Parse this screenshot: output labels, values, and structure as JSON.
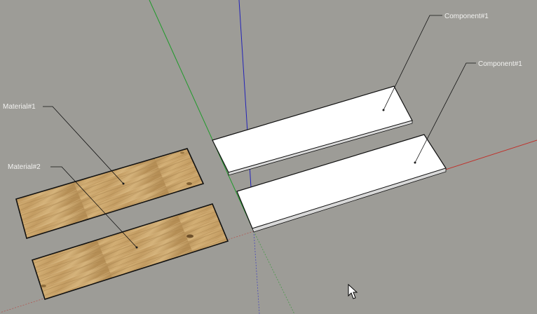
{
  "scene": {
    "background_color": "#9d9c97",
    "axis_colors": {
      "red": "#c0302a",
      "green": "#1f9a2a",
      "blue": "#2323b8"
    },
    "cursor_icon": "arrow-cursor-icon"
  },
  "labels": {
    "component_1_top": "Component#1",
    "component_1_bottom": "Component#1",
    "material_1": "Material#1",
    "material_2": "Material#2"
  },
  "materials": {
    "wood_base": "#c9a46a",
    "wood_grain": "#8a6a3c",
    "board_face": "#ffffff",
    "board_edge": "#d8d8d8"
  }
}
